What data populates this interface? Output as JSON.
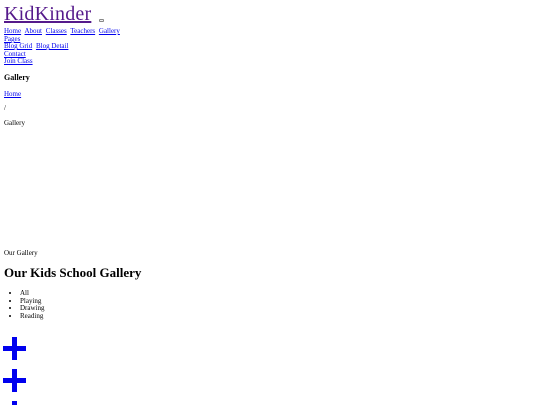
{
  "navbar": {
    "brand": "KidKinder",
    "links": {
      "home": "Home",
      "about": "About",
      "classes": "Classes",
      "teachers": "Teachers",
      "gallery": "Gallery",
      "pages": "Pages",
      "blog_grid": "Blog Grid",
      "blog_detail": "Blog Detail",
      "contact": "Contact"
    },
    "cta": "Join Class"
  },
  "page_header": {
    "title": "Gallery",
    "breadcrumb": {
      "home": "Home",
      "separator": "/",
      "current": "Gallery"
    }
  },
  "gallery_section": {
    "subtitle": "Our Gallery",
    "title": "Our Kids School Gallery",
    "filters": [
      "All",
      "Playing",
      "Drawing",
      "Reading"
    ]
  },
  "colors": {
    "link": "#0000ee",
    "visited_link": "#551a8b",
    "icon": "#0000ee"
  },
  "icons": {
    "gallery_item": "plus-icon"
  }
}
